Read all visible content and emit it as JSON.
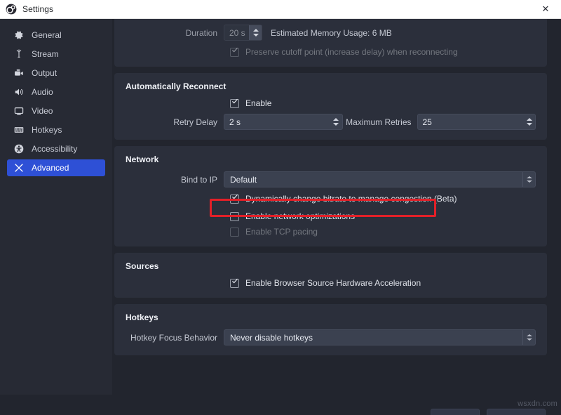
{
  "window": {
    "title": "Settings",
    "app_icon": "obs-logo-icon",
    "close_label": "✕"
  },
  "sidebar": {
    "items": [
      {
        "label": "General",
        "icon": "gear-icon",
        "selected": false
      },
      {
        "label": "Stream",
        "icon": "broadcast-icon",
        "selected": false
      },
      {
        "label": "Output",
        "icon": "output-screen-icon",
        "selected": false
      },
      {
        "label": "Audio",
        "icon": "speaker-icon",
        "selected": false
      },
      {
        "label": "Video",
        "icon": "monitor-icon",
        "selected": false
      },
      {
        "label": "Hotkeys",
        "icon": "keyboard-icon",
        "selected": false
      },
      {
        "label": "Accessibility",
        "icon": "accessibility-icon",
        "selected": false
      },
      {
        "label": "Advanced",
        "icon": "tools-icon",
        "selected": true
      }
    ]
  },
  "panels": {
    "replay_buffer": {
      "duration_label": "Duration",
      "duration_value": "20 s",
      "memory_note": "Estimated Memory Usage: 6 MB",
      "preserve_cutoff_label": "Preserve cutoff point (increase delay) when reconnecting",
      "preserve_cutoff_checked": true,
      "preserve_cutoff_enabled": false
    },
    "auto_reconnect": {
      "title": "Automatically Reconnect",
      "enable_label": "Enable",
      "enable_checked": true,
      "retry_delay_label": "Retry Delay",
      "retry_delay_value": "2 s",
      "max_retries_label": "Maximum Retries",
      "max_retries_value": "25"
    },
    "network": {
      "title": "Network",
      "bind_ip_label": "Bind to IP",
      "bind_ip_value": "Default",
      "dynamic_bitrate_label": "Dynamically change bitrate to manage congestion (Beta)",
      "dynamic_bitrate_checked": true,
      "network_optimizations_label": "Enable network optimizations",
      "network_optimizations_checked": false,
      "tcp_pacing_label": "Enable TCP pacing",
      "tcp_pacing_checked": false,
      "tcp_pacing_enabled": false
    },
    "sources": {
      "title": "Sources",
      "browser_hw_accel_label": "Enable Browser Source Hardware Acceleration",
      "browser_hw_accel_checked": true
    },
    "hotkeys": {
      "title": "Hotkeys",
      "focus_behavior_label": "Hotkey Focus Behavior",
      "focus_behavior_value": "Never disable hotkeys"
    }
  },
  "annotation": {
    "highlight_color": "#e32028",
    "highlight_target": "dynamic-bitrate-checkbox-row"
  },
  "watermark": {
    "text": "wsxdn.com"
  },
  "theme": {
    "accent": "#2e50d6",
    "panel_bg": "#2b2f3b",
    "window_bg": "#22252e",
    "sidebar_bg": "#272a34",
    "field_bg": "#3b4150"
  }
}
